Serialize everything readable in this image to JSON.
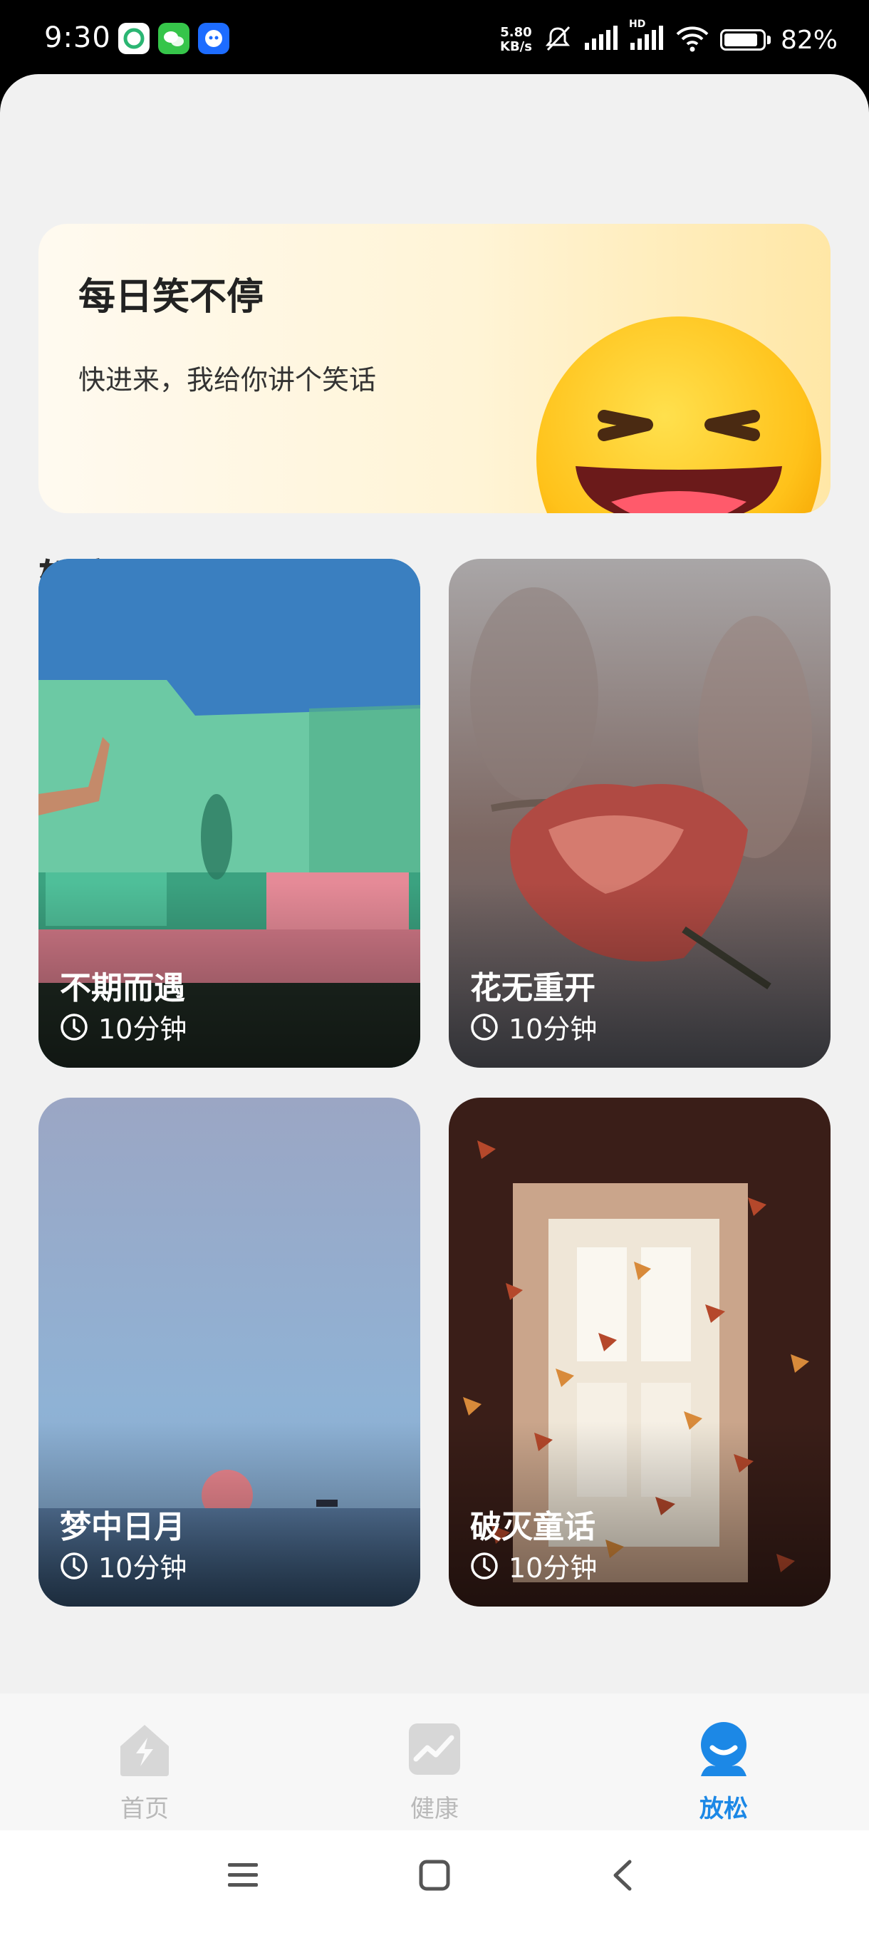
{
  "status_bar": {
    "time": "9:30",
    "net_speed_value": "5.80",
    "net_speed_unit": "KB/s",
    "signal_tag": "HD",
    "battery": "82%",
    "icons": [
      "app-icon-1",
      "wechat-icon",
      "app-icon-3",
      "mute-icon",
      "signal-icon",
      "hd-signal-icon",
      "wifi-icon",
      "battery-icon"
    ]
  },
  "joke_card": {
    "title": "每日笑不停",
    "subtitle": "快进来，我给你讲个笑话",
    "icon": "laughing-emoji-icon"
  },
  "section": {
    "title": "轻音乐"
  },
  "music_cards": [
    {
      "title": "不期而遇",
      "duration": "10分钟"
    },
    {
      "title": "花无重开",
      "duration": "10分钟"
    },
    {
      "title": "梦中日月",
      "duration": "10分钟"
    },
    {
      "title": "破灭童话",
      "duration": "10分钟"
    }
  ],
  "tabs": [
    {
      "label": "首页",
      "icon": "home-icon",
      "active": false
    },
    {
      "label": "健康",
      "icon": "health-chart-icon",
      "active": false
    },
    {
      "label": "放松",
      "icon": "relax-icon",
      "active": true
    }
  ],
  "colors": {
    "accent": "#1c88e6",
    "inactive_tab": "#b9b9b9",
    "background": "#f1f1f1"
  }
}
